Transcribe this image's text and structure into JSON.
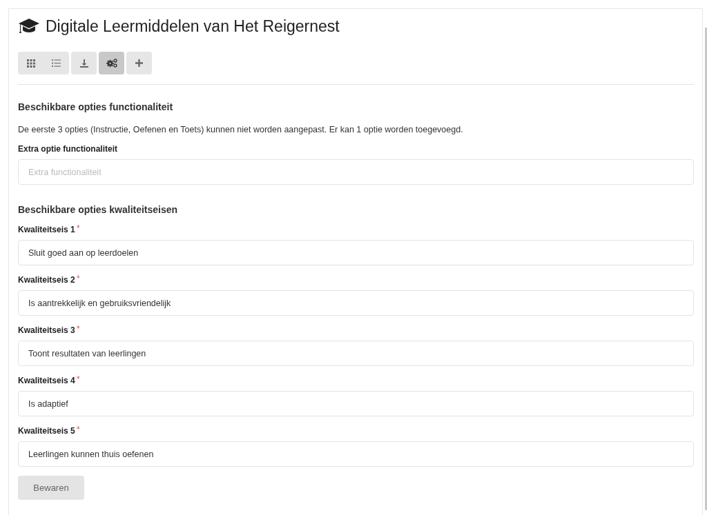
{
  "title": "Digitale Leermiddelen van Het Reigernest",
  "toolbar": [
    {
      "kind": "grid",
      "joined": false,
      "selected": false
    },
    {
      "kind": "list",
      "joined": true,
      "selected": false
    },
    {
      "kind": "download",
      "joined": false,
      "selected": false
    },
    {
      "kind": "settings",
      "joined": false,
      "selected": true
    },
    {
      "kind": "add",
      "joined": false,
      "selected": false
    }
  ],
  "sections": [
    {
      "heading": "Beschikbare opties functionaliteit",
      "description": "De eerste 3 opties (Instructie, Oefenen en Toets) kunnen niet worden aangepast. Er kan 1 optie worden toegevoegd.",
      "fields": [
        {
          "label": "Extra optie functionaliteit",
          "placeholder": "Extra functionaliteit"
        }
      ]
    },
    {
      "heading": "Beschikbare opties kwaliteitseisen",
      "fields": [
        {
          "label": "Kwaliteitseis 1",
          "required_mark": "*",
          "value": "Sluit goed aan op leerdoelen"
        },
        {
          "label": "Kwaliteitseis 2",
          "required_mark": "*",
          "value": "Is aantrekkelijk en gebruiksvriendelijk"
        },
        {
          "label": "Kwaliteitseis 3",
          "required_mark": "*",
          "value": "Toont resultaten van leerlingen"
        },
        {
          "label": "Kwaliteitseis 4",
          "required_mark": "*",
          "value": "Is adaptief"
        },
        {
          "label": "Kwaliteitseis 5",
          "required_mark": "*",
          "value": "Leerlingen kunnen thuis oefenen"
        }
      ]
    }
  ],
  "save_button": {
    "label": "Bewaren",
    "disabled": true
  }
}
